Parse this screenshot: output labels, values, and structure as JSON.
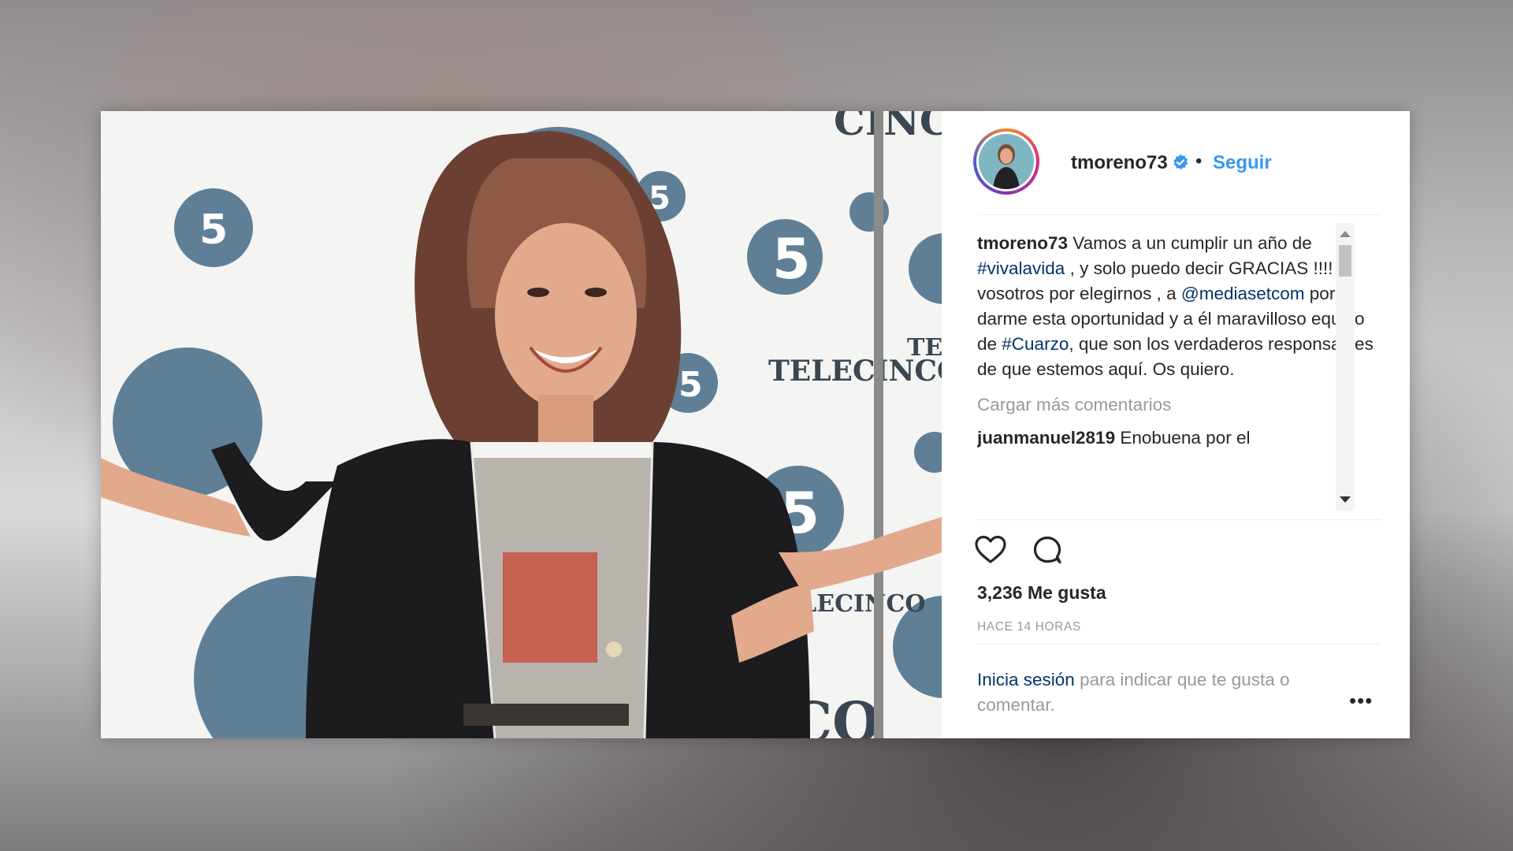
{
  "post": {
    "username": "tmoreno73",
    "follow_label": "Seguir",
    "separator": "•",
    "caption": {
      "user": "tmoreno73",
      "part1": " Vamos a un cumplir un año de ",
      "hashtag1": "#vivalavida",
      "part2": " , y solo puedo decir GRACIAS !!!! A vosotros por elegirnos , a ",
      "mention": "@mediasetcom",
      "part3": " por darme esta oportunidad y a él maravilloso equipo de ",
      "hashtag2": "#Cuarzo",
      "part4": ", que son los verdaderos responsables de que estemos aquí. Os quiero."
    },
    "load_more_label": "Cargar más comentarios",
    "comment": {
      "user": "juanmanuel2819",
      "text": " Enobuena por el"
    },
    "likes_label": "3,236 Me gusta",
    "time_label": "HACE 14 HORAS",
    "login_link": "Inicia sesión",
    "login_text": " para indicar que te gusta o comentar.",
    "more_label": "•••",
    "photo_wall_text": [
      "TELECINCO",
      "TELECINCO",
      "TEL",
      "CINCO",
      "5"
    ]
  },
  "icons": {
    "verified": "verified-badge-icon",
    "like": "heart-icon",
    "comment": "comment-bubble-icon",
    "more": "more-options-icon"
  },
  "colors": {
    "link_blue": "#3897f0",
    "hashtag": "#003569",
    "muted": "#999999",
    "text": "#262626",
    "telecinco_blue": "#5f7f97"
  }
}
